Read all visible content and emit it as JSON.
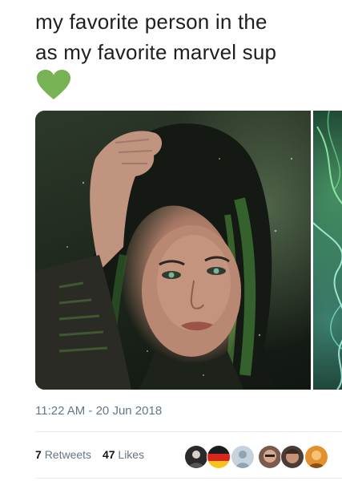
{
  "tweet": {
    "text_line_1": "my favorite person in the",
    "text_line_2": "as my favorite marvel sup",
    "emoji": "green-heart",
    "accent_color": "#77b255",
    "timestamp": "11:22 AM - 20 Jun 2018",
    "stats": {
      "retweets_count": "7",
      "retweets_label": "Retweets",
      "likes_count": "47",
      "likes_label": "Likes"
    },
    "liker_avatars": [
      {
        "icon": "avatar-dark"
      },
      {
        "icon": "avatar-flag"
      },
      {
        "icon": "avatar-default"
      },
      {
        "icon": "avatar-face"
      },
      {
        "icon": "avatar-face"
      },
      {
        "icon": "avatar-orange"
      }
    ]
  }
}
